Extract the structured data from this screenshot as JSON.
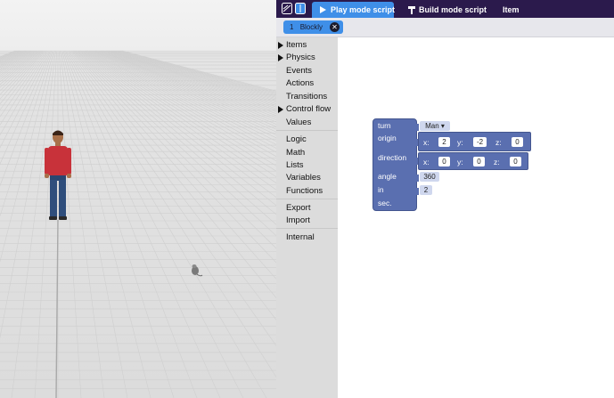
{
  "topbar": {
    "tabs": [
      {
        "label": "Play mode script",
        "active": true
      },
      {
        "label": "Build mode script",
        "active": false
      },
      {
        "label": "Item",
        "active": false
      }
    ]
  },
  "subbar": {
    "blockly_tab": {
      "number": "1",
      "label": "Blockly",
      "close": "✕"
    }
  },
  "toolbox": {
    "categories": [
      {
        "label": "Items",
        "expandable": true
      },
      {
        "label": "Physics",
        "expandable": true
      },
      {
        "label": "Events",
        "expandable": false
      },
      {
        "label": "Actions",
        "expandable": false
      },
      {
        "label": "Transitions",
        "expandable": false
      },
      {
        "label": "Control flow",
        "expandable": true
      },
      {
        "label": "Values",
        "expandable": false
      },
      {
        "label": "Logic",
        "expandable": false
      },
      {
        "label": "Math",
        "expandable": false
      },
      {
        "label": "Lists",
        "expandable": false
      },
      {
        "label": "Variables",
        "expandable": false
      },
      {
        "label": "Functions",
        "expandable": false
      },
      {
        "label": "Export",
        "expandable": false
      },
      {
        "label": "Import",
        "expandable": false
      },
      {
        "label": "Internal",
        "expandable": false
      }
    ]
  },
  "block": {
    "turn_label": "turn",
    "target": "Man",
    "target_arrow": "▾",
    "origin_label": "origin",
    "origin": {
      "x_label": "x:",
      "x": "2",
      "y_label": "y:",
      "y": "-2",
      "z_label": "z:",
      "z": "0"
    },
    "direction_label": "direction",
    "direction": {
      "x_label": "x:",
      "x": "0",
      "y_label": "y:",
      "y": "0",
      "z_label": "z:",
      "z": "0"
    },
    "angle_label": "angle",
    "angle": "360",
    "in_label": "in",
    "duration": "2",
    "sec_label": "sec."
  },
  "colors": {
    "topbar_bg": "#2b1a4c",
    "active_tab": "#3f8fe8",
    "block": "#5a6fb0",
    "toolbox_bg": "#dcdcdc"
  },
  "icons": [
    "layers-icon",
    "book-icon",
    "play-icon",
    "hammer-icon",
    "close-icon",
    "dropdown-arrow-icon",
    "expand-triangle-icon"
  ]
}
